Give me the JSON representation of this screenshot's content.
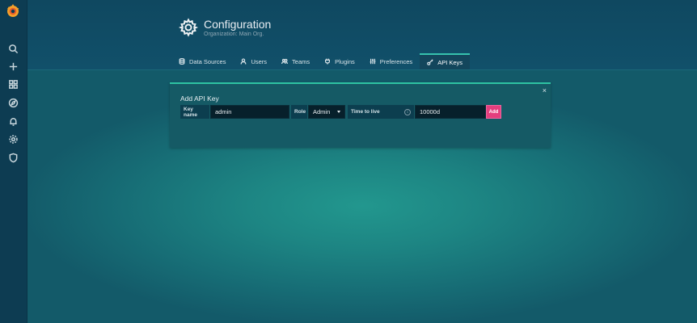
{
  "page": {
    "title": "Configuration",
    "subtitle": "Organization: Main Org."
  },
  "sidebar": {
    "icons": [
      "grafana-logo",
      "search-icon",
      "plus-icon",
      "dashboards-icon",
      "explore-icon",
      "alerting-icon",
      "gear-icon",
      "shield-icon"
    ]
  },
  "tabs": [
    {
      "label": "Data Sources",
      "icon": "database-icon",
      "active": false
    },
    {
      "label": "Users",
      "icon": "user-icon",
      "active": false
    },
    {
      "label": "Teams",
      "icon": "users-icon",
      "active": false
    },
    {
      "label": "Plugins",
      "icon": "plug-icon",
      "active": false
    },
    {
      "label": "Preferences",
      "icon": "sliders-icon",
      "active": false
    },
    {
      "label": "API Keys",
      "icon": "key-icon",
      "active": true
    }
  ],
  "add_api_key": {
    "heading": "Add API Key",
    "close_label": "×",
    "key_name_label": "Key name",
    "key_name_value": "admin",
    "role_label": "Role",
    "role_value": "Admin",
    "ttl_label": "Time to live",
    "ttl_info": "i",
    "ttl_value": "10000d",
    "add_label": "Add"
  },
  "colors": {
    "accent": "#2ec3a3",
    "add_button": "#e33e7d",
    "tab_active_border": "#36c2ae"
  }
}
